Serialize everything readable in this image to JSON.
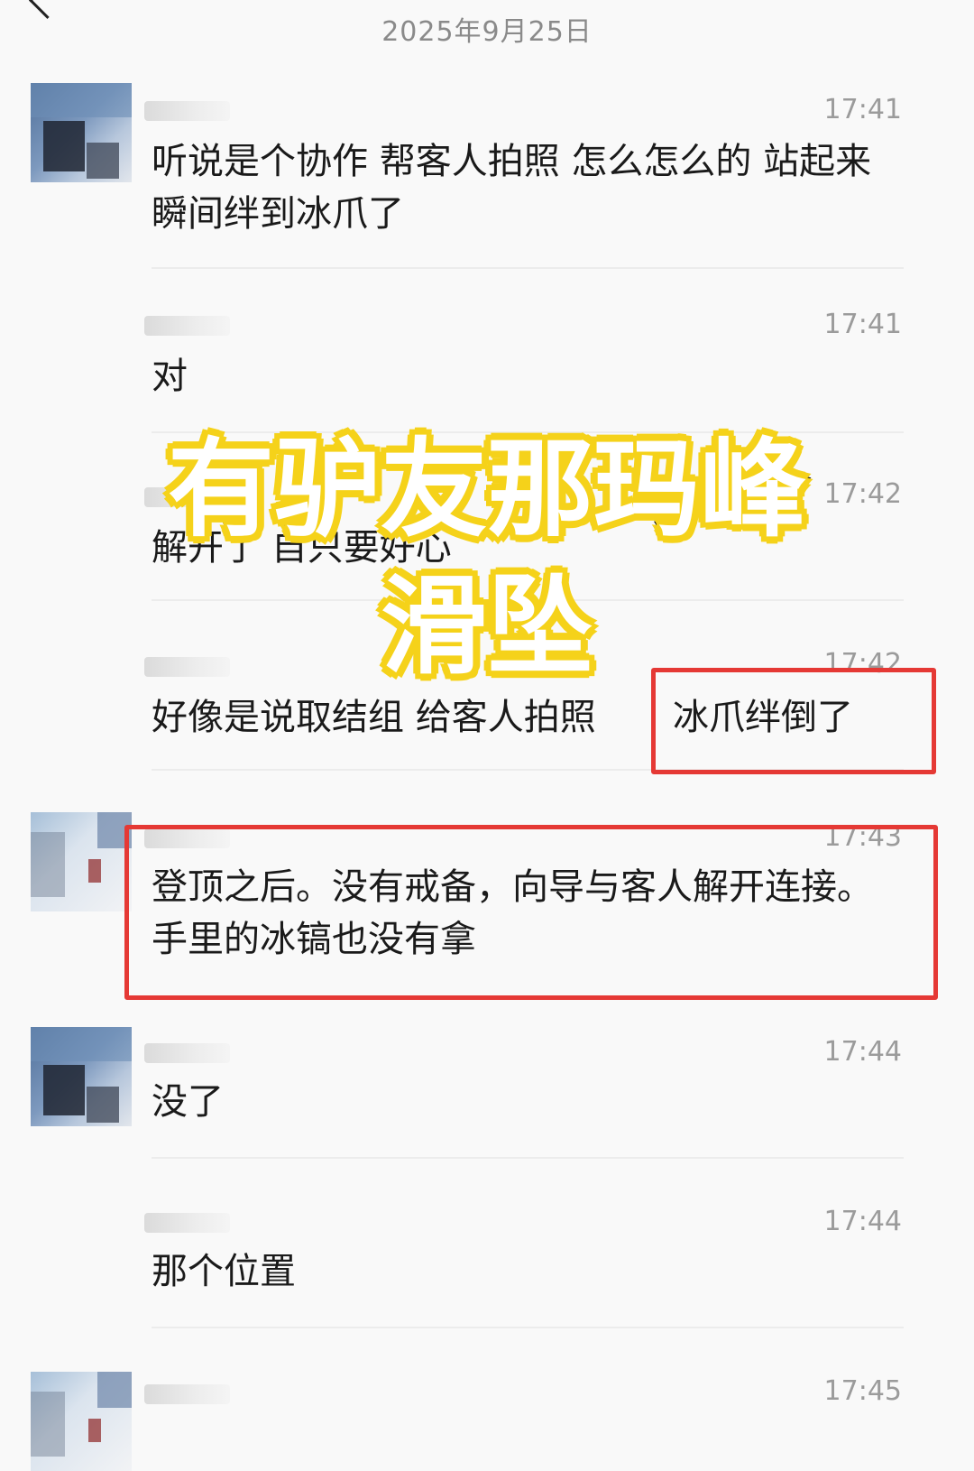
{
  "header": {
    "date": "2025年9月25日",
    "back_icon": "chevron-left-icon"
  },
  "messages": [
    {
      "time": "17:41",
      "text": "听说是个协作 帮客人拍照 怎么怎么的 站起来瞬间绊到冰爪了",
      "has_avatar": true
    },
    {
      "time": "17:41",
      "text": "对",
      "has_avatar": false
    },
    {
      "time": "17:42",
      "text": "解开了 自只要好心",
      "has_avatar": false
    },
    {
      "time": "17:42",
      "text": "好像是说取结组 给客人拍照",
      "highlight_text": "冰爪绊倒了",
      "has_avatar": false
    },
    {
      "time": "17:43",
      "text": "登顶之后。没有戒备，向导与客人解开连接。手里的冰镐也没有拿",
      "has_avatar": true
    },
    {
      "time": "17:44",
      "text": "没了",
      "has_avatar": true
    },
    {
      "time": "17:44",
      "text": "那个位置",
      "has_avatar": false
    },
    {
      "time": "17:45",
      "text": "",
      "has_avatar": true
    }
  ],
  "overlay": {
    "line1": "有驴友那玛峰",
    "line2": "滑坠"
  },
  "colors": {
    "highlight_border": "#e53935",
    "overlay_outline": "#f5d21a",
    "background": "#f9f9f9"
  }
}
